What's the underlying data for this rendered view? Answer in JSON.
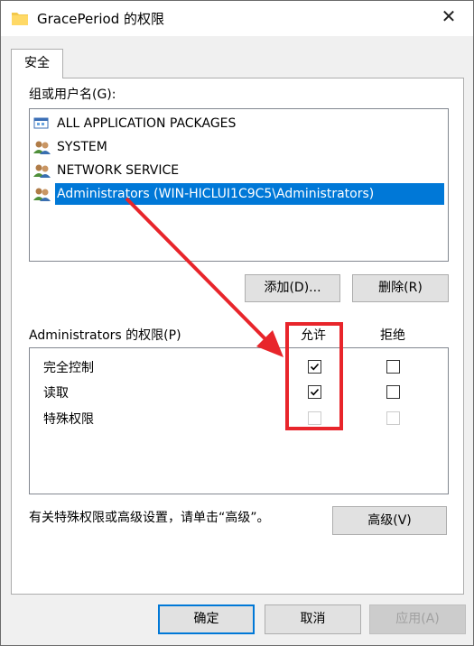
{
  "window": {
    "title": "GracePeriod 的权限",
    "close_glyph": "✕"
  },
  "tab": {
    "label": "安全"
  },
  "groups": {
    "label": "组或用户名(G):",
    "items": [
      {
        "name": "ALL APPLICATION PACKAGES",
        "icon": "app-packages-icon",
        "selected": false
      },
      {
        "name": "SYSTEM",
        "icon": "users-icon",
        "selected": false
      },
      {
        "name": "NETWORK SERVICE",
        "icon": "users-icon",
        "selected": false
      },
      {
        "name": "Administrators (WIN-HICLUI1C9C5\\Administrators)",
        "icon": "users-icon",
        "selected": true
      }
    ],
    "add_button": "添加(D)...",
    "remove_button": "删除(R)"
  },
  "permissions": {
    "label": "Administrators 的权限(P)",
    "allow_header": "允许",
    "deny_header": "拒绝",
    "rows": [
      {
        "name": "完全控制",
        "allow": true,
        "deny": false,
        "disabled": false
      },
      {
        "name": "读取",
        "allow": true,
        "deny": false,
        "disabled": false
      },
      {
        "name": "特殊权限",
        "allow": false,
        "deny": false,
        "disabled": true
      }
    ]
  },
  "advanced": {
    "note": "有关特殊权限或高级设置，请单击“高级”。",
    "button": "高级(V)"
  },
  "footer": {
    "ok": "确定",
    "cancel": "取消",
    "apply": "应用(A)"
  },
  "colors": {
    "selection": "#0078d7",
    "annotation": "#e8252b",
    "default_button_border": "#0078d7"
  }
}
